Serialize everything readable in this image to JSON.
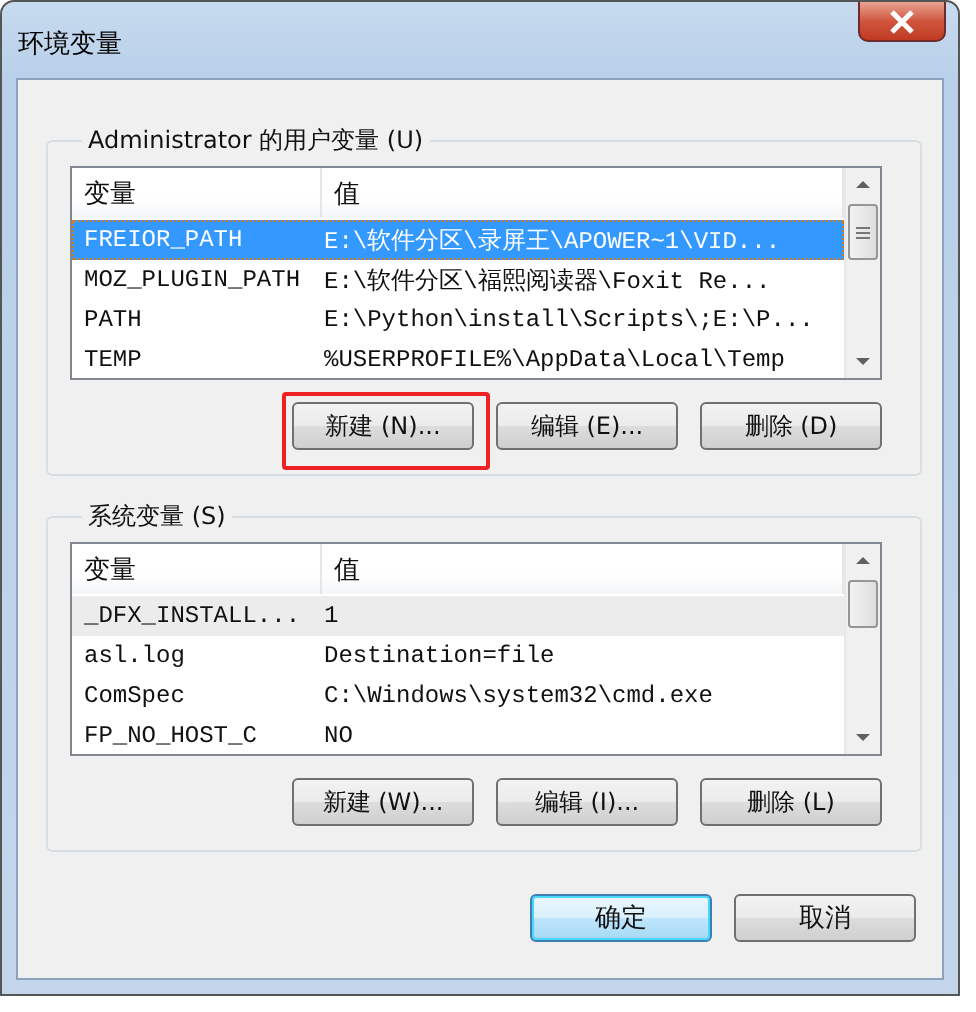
{
  "window": {
    "title": "环境变量"
  },
  "user_variables": {
    "title": "Administrator 的用户变量 (U)",
    "columns": [
      "变量",
      "值"
    ],
    "rows": [
      {
        "name": "FREIOR_PATH",
        "value": "E:\\软件分区\\录屏王\\APOWER~1\\VID...",
        "selected": true,
        "focused": true
      },
      {
        "name": "MOZ_PLUGIN_PATH",
        "value": "E:\\软件分区\\福熙阅读器\\Foxit Re...",
        "selected": false,
        "focused": false
      },
      {
        "name": "PATH",
        "value": "E:\\Python\\install\\Scripts\\;E:\\P...",
        "selected": false,
        "focused": false
      },
      {
        "name": "TEMP",
        "value": "%USERPROFILE%\\AppData\\Local\\Temp",
        "selected": false,
        "focused": false
      }
    ],
    "buttons": [
      {
        "label": "新建 (N)...",
        "highlighted": true
      },
      {
        "label": "编辑 (E)...",
        "highlighted": false
      },
      {
        "label": "删除 (D)",
        "highlighted": false
      }
    ]
  },
  "system_variables": {
    "title": "系统变量 (S)",
    "columns": [
      "变量",
      "值"
    ],
    "rows": [
      {
        "name": "_DFX_INSTALL...",
        "value": "1",
        "selected": false,
        "focused": true
      },
      {
        "name": "asl.log",
        "value": "Destination=file",
        "selected": false,
        "focused": false
      },
      {
        "name": "ComSpec",
        "value": "C:\\Windows\\system32\\cmd.exe",
        "selected": false,
        "focused": false
      },
      {
        "name": "FP_NO_HOST_C",
        "value": "NO",
        "selected": false,
        "focused": false
      }
    ],
    "buttons": [
      {
        "label": "新建 (W)...",
        "highlighted": false
      },
      {
        "label": "编辑 (I)...",
        "highlighted": false
      },
      {
        "label": "删除 (L)",
        "highlighted": false
      }
    ]
  },
  "buttons": [
    {
      "label": "确定",
      "default": true
    },
    {
      "label": "取消",
      "default": false
    }
  ]
}
